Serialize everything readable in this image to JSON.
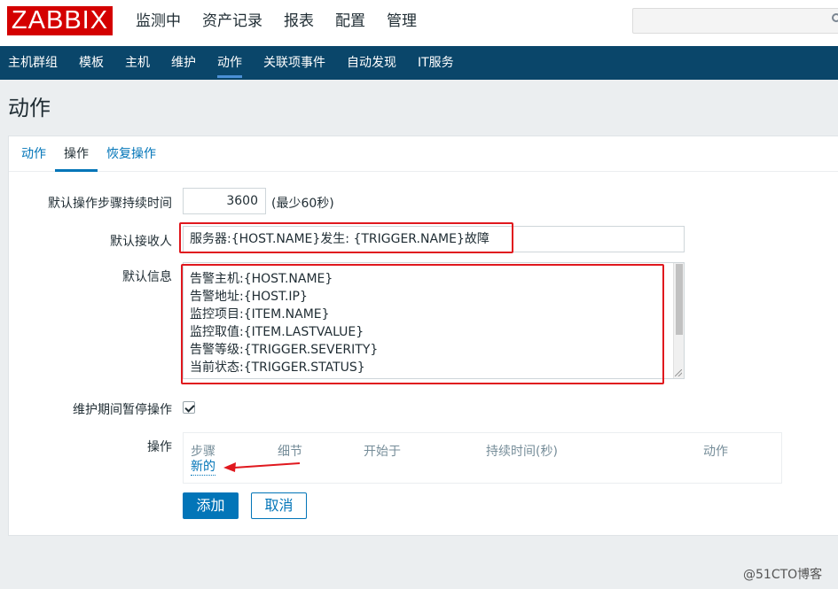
{
  "logo": "ZABBIX",
  "main_menu": [
    "监测中",
    "资产记录",
    "报表",
    "配置",
    "管理"
  ],
  "main_menu_active": "配置",
  "search": {
    "value": "",
    "placeholder": ""
  },
  "sub_menu": [
    "主机群组",
    "模板",
    "主机",
    "维护",
    "动作",
    "关联项事件",
    "自动发现",
    "IT服务"
  ],
  "sub_menu_active": "动作",
  "page_title": "动作",
  "tabs": [
    "动作",
    "操作",
    "恢复操作"
  ],
  "tabs_active": "操作",
  "form": {
    "step_duration_label": "默认操作步骤持续时间",
    "step_duration_value": "3600",
    "step_duration_hint": "(最少60秒)",
    "recipient_label": "默认接收人",
    "recipient_value": "服务器:{HOST.NAME}发生: {TRIGGER.NAME}故障",
    "message_label": "默认信息",
    "message_lines": [
      "告警主机:{HOST.NAME}",
      "告警地址:{HOST.IP}",
      "监控项目:{ITEM.NAME}",
      "监控取值:{ITEM.LASTVALUE}",
      "告警等级:{TRIGGER.SEVERITY}",
      "当前状态:{TRIGGER.STATUS}"
    ],
    "pause_label": "维护期间暂停操作",
    "pause_checked": true,
    "operations_label": "操作",
    "operations_columns": [
      "步骤",
      "细节",
      "开始于",
      "持续时间(秒)",
      "动作"
    ],
    "new_link": "新的"
  },
  "buttons": {
    "add": "添加",
    "cancel": "取消"
  },
  "watermark": "@51CTO博客",
  "colors": {
    "brand_red": "#d40000",
    "nav_blue": "#0a466a",
    "link_blue": "#0275b8",
    "highlight_red": "#e0181e"
  }
}
